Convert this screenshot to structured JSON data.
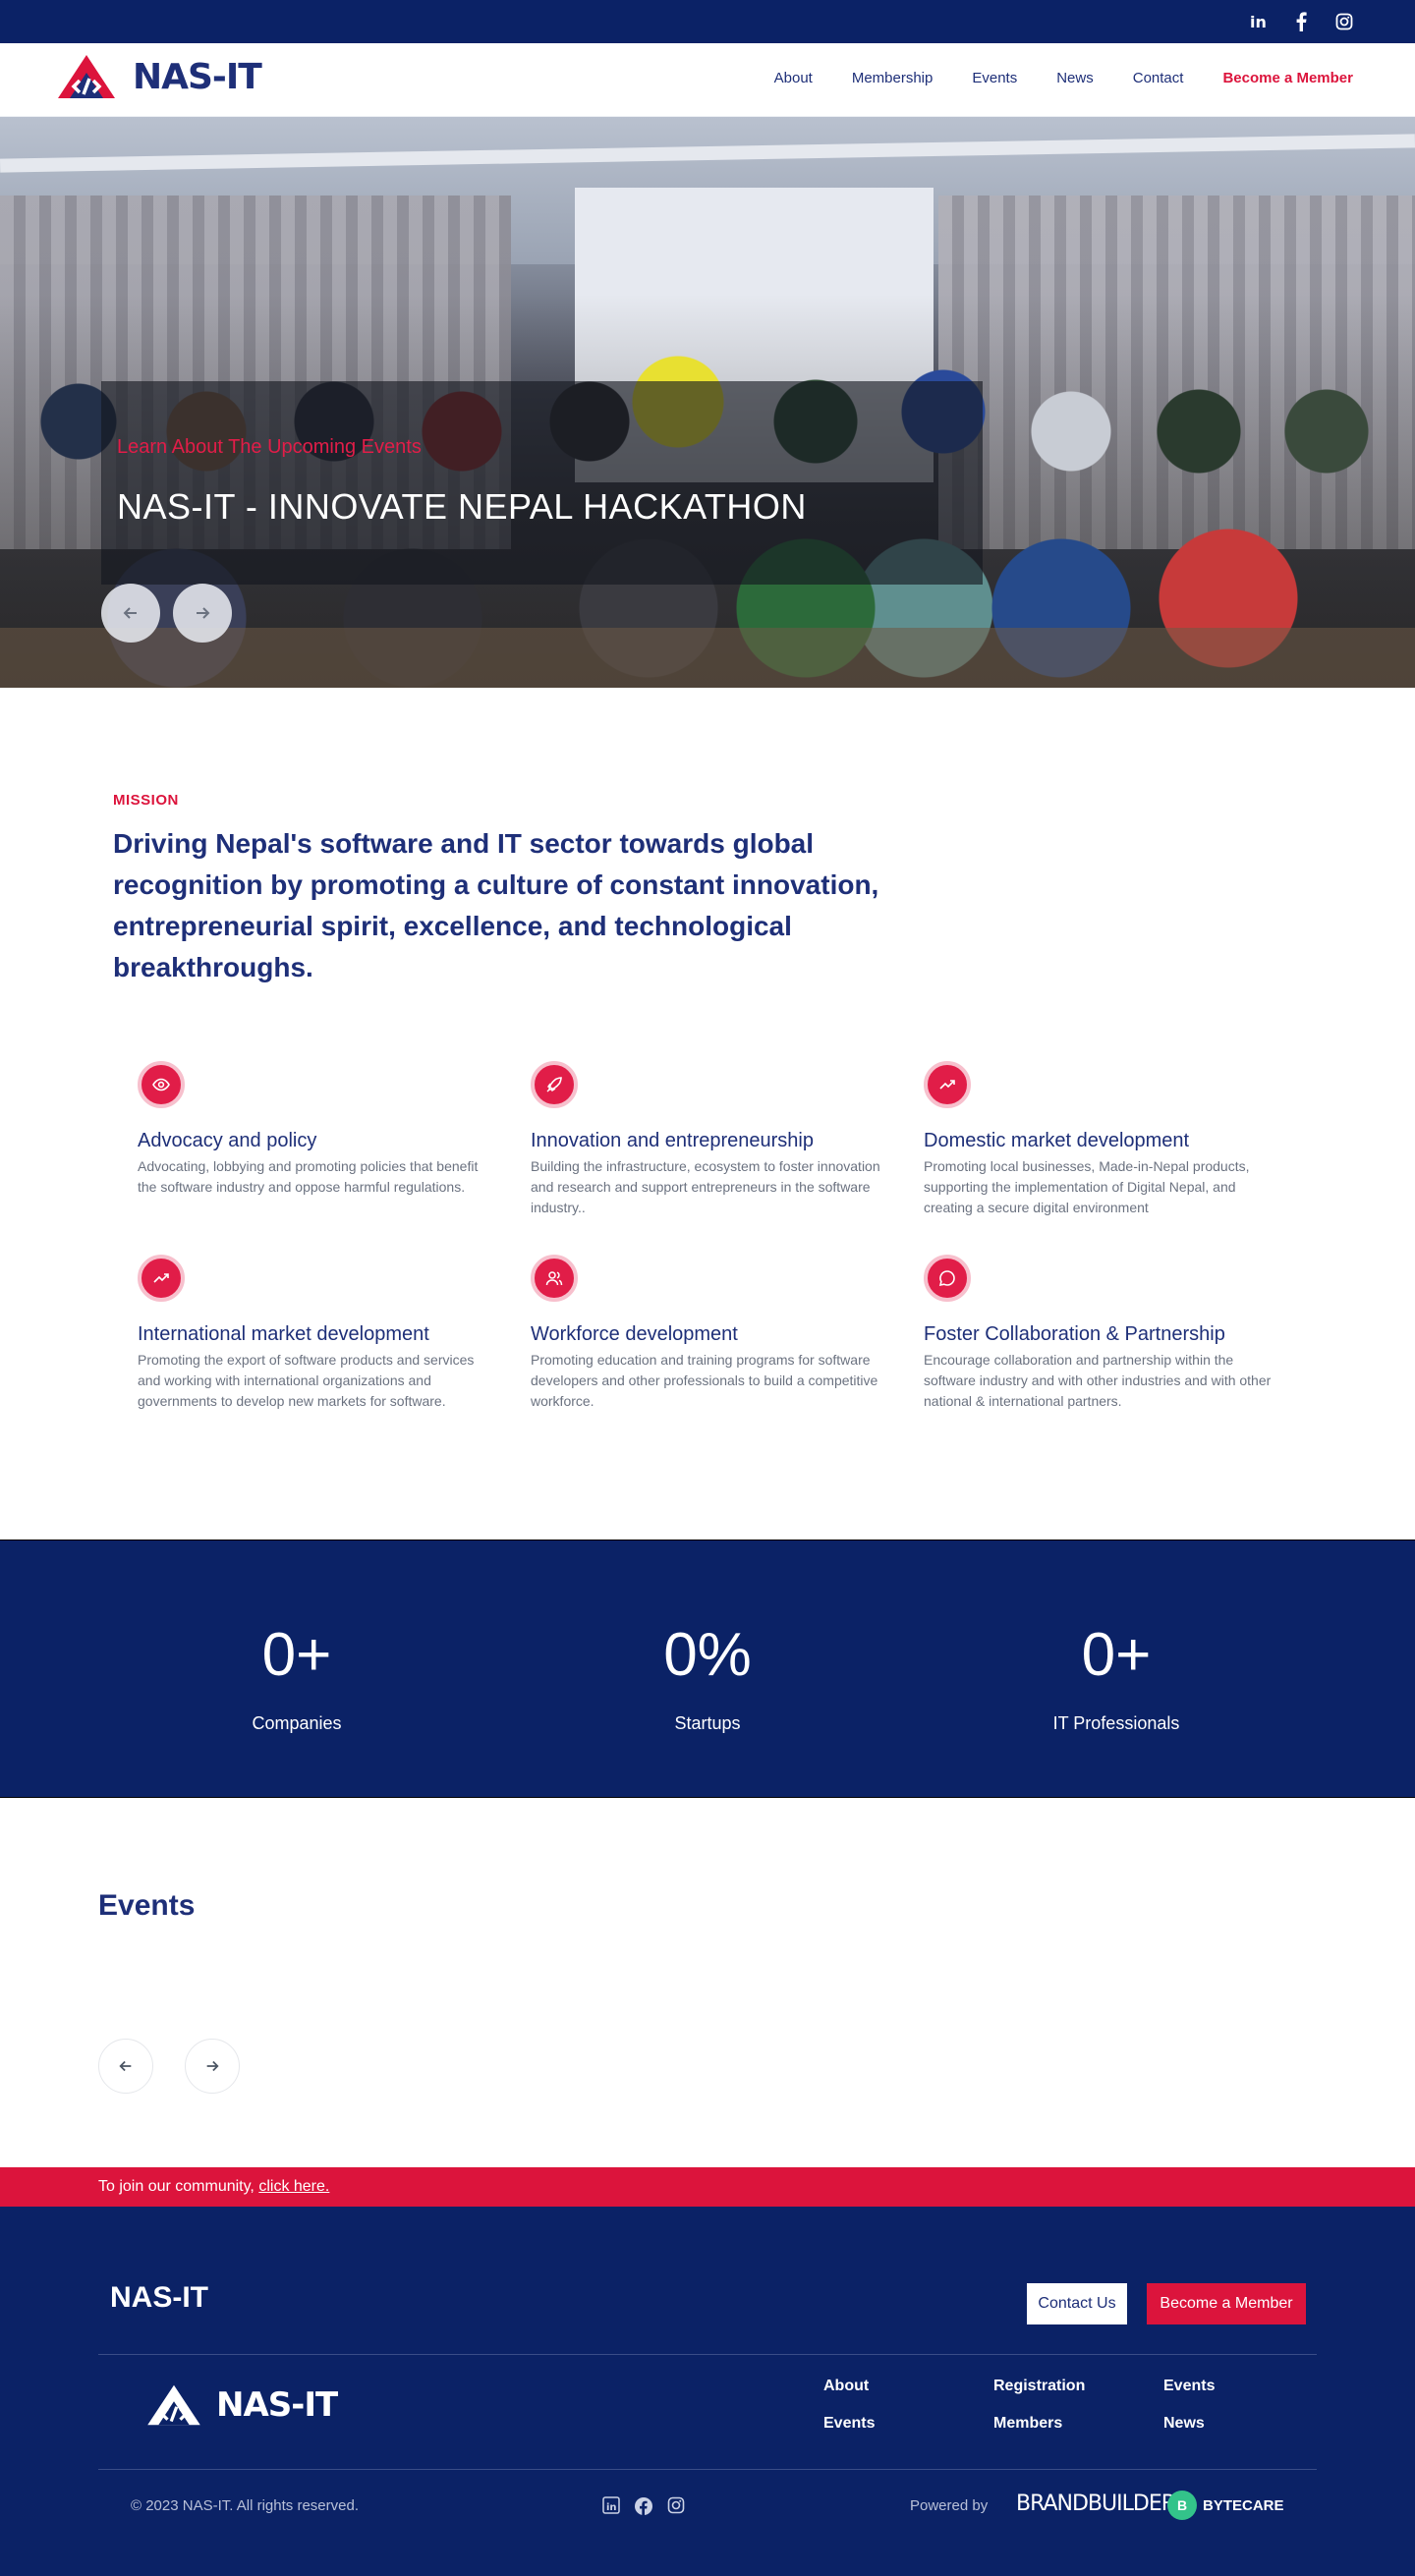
{
  "brand": {
    "name": "NAS-IT",
    "colors": {
      "navy": "#0b2266",
      "accent": "#dc143c",
      "heading": "#1e2f78",
      "muted": "#6b7280"
    }
  },
  "topbar": {
    "social_icons": [
      "linkedin-icon",
      "facebook-icon",
      "instagram-icon"
    ]
  },
  "nav": {
    "items": [
      {
        "label": "About"
      },
      {
        "label": "Membership"
      },
      {
        "label": "Events"
      },
      {
        "label": "News"
      },
      {
        "label": "Contact"
      }
    ],
    "cta_label": "Become a Member"
  },
  "hero": {
    "kicker": "Learn About The Upcoming Events",
    "title": "NAS-IT - INNOVATE NEPAL HACKATHON",
    "prev_icon": "arrow-left-icon",
    "next_icon": "arrow-right-icon"
  },
  "mission": {
    "label": "MISSION",
    "text": "Driving Nepal's software and IT sector towards global recognition by promoting a culture of constant innovation, entrepreneurial spirit, excellence, and technological breakthroughs.",
    "pillars": [
      {
        "icon": "eye-icon",
        "title": "Advocacy and policy",
        "text": "Advocating, lobbying and promoting policies that benefit the software industry and oppose harmful regulations."
      },
      {
        "icon": "rocket-icon",
        "title": "Innovation and entrepreneurship",
        "text": "Building the infrastructure, ecosystem to foster innovation and research and support entrepreneurs in the software industry.."
      },
      {
        "icon": "trending-up-icon",
        "title": "Domestic market development",
        "text": "Promoting local businesses, Made-in-Nepal products, supporting the implementation of Digital Nepal, and creating a secure digital environment"
      },
      {
        "icon": "trending-up-icon",
        "title": "International market development",
        "text": "Promoting the export of software products and services and working with international organizations and governments to develop new markets for software."
      },
      {
        "icon": "users-icon",
        "title": "Workforce development",
        "text": "Promoting education and training programs for software developers and other professionals to build a competitive workforce."
      },
      {
        "icon": "chat-bubble-icon",
        "title": "Foster Collaboration & Partnership",
        "text": "Encourage collaboration and partnership within the software industry and with other industries and with other national & international partners."
      }
    ]
  },
  "stats": [
    {
      "value": "0+",
      "label": "Companies"
    },
    {
      "value": "0%",
      "label": "Startups"
    },
    {
      "value": "0+",
      "label": "IT Professionals"
    }
  ],
  "events": {
    "title": "Events",
    "prev_icon": "arrow-left-icon",
    "next_icon": "arrow-right-icon"
  },
  "join": {
    "text": "To join our community,",
    "link": "click here."
  },
  "footer": {
    "brand": "NAS-IT",
    "contact_label": "Contact Us",
    "member_label": "Become a Member",
    "links": [
      "About",
      "Registration",
      "Events",
      "Events",
      "Members",
      "News"
    ],
    "copyright": "© 2023 NAS-IT. All rights reserved.",
    "social_icons": [
      "linkedin-icon",
      "facebook-icon",
      "instagram-icon"
    ],
    "powered_by": "Powered by",
    "partner1": "BRANDBUILDER",
    "partner2": "BYTECARE"
  }
}
